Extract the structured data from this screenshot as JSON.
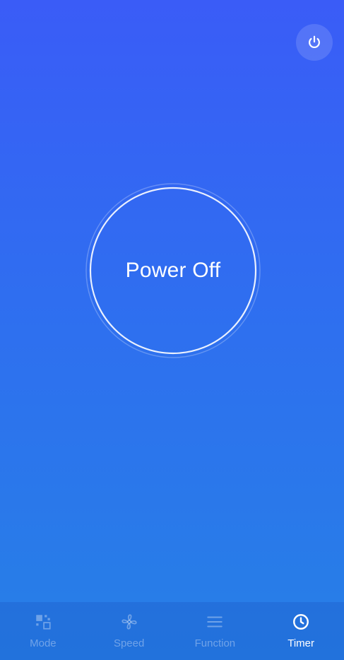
{
  "header": {
    "power_icon": "power-icon"
  },
  "status": {
    "label": "Power Off"
  },
  "nav": {
    "items": [
      {
        "label": "Mode",
        "icon": "mode-icon",
        "active": false
      },
      {
        "label": "Speed",
        "icon": "fan-icon",
        "active": false
      },
      {
        "label": "Function",
        "icon": "menu-icon",
        "active": false
      },
      {
        "label": "Timer",
        "icon": "clock-icon",
        "active": true
      }
    ]
  },
  "colors": {
    "gradient_top": "#3a5cf7",
    "gradient_bottom": "#2680e6",
    "text": "#ffffff",
    "inactive": "rgba(255,255,255,0.35)"
  }
}
